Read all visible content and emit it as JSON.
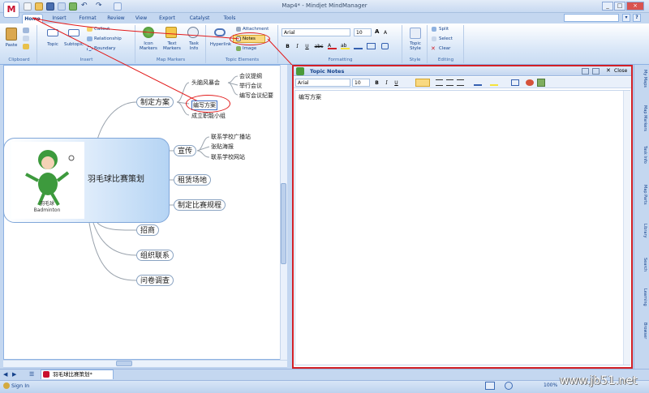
{
  "window": {
    "title": "Map4* - Mindjet MindManager",
    "app_button": "M",
    "controls": [
      "_",
      "□",
      "×"
    ]
  },
  "tabs": [
    "Home",
    "Insert",
    "Format",
    "Review",
    "View",
    "Export",
    "Catalyst",
    "Tools"
  ],
  "ribbon": {
    "clipboard": {
      "paste": "Paste",
      "label": "Clipboard"
    },
    "insert": {
      "topic": "Topic",
      "subtopic": "Subtopic",
      "callout": "Callout",
      "relationship": "Relationship",
      "boundary": "Boundary",
      "label": "Insert"
    },
    "map_markers": {
      "icon_markers": "Icon\nMarkers",
      "text_markers": "Text\nMarkers",
      "task_info": "Task\nInfo",
      "label": "Map Markers"
    },
    "topic_elements": {
      "hyperlink": "Hyperlink",
      "attachment": "Attachment",
      "notes": "Notes",
      "image": "Image",
      "label": "Topic Elements"
    },
    "formatting": {
      "font": "Arial",
      "size": "10",
      "bold": "B",
      "italic": "I",
      "underline": "U",
      "strike": "abc",
      "label": "Formatting"
    },
    "style": {
      "topic_style": "Topic\nStyle",
      "label": "Style"
    },
    "editing": {
      "split": "Split",
      "select": "Select",
      "clear": "Clear",
      "label": "Editing"
    }
  },
  "map": {
    "central": {
      "title": "羽毛球比赛策划",
      "img_caption_cn": "羽毛球",
      "img_caption_en": "Badminton"
    },
    "topics": [
      {
        "label": "制定方案",
        "subs": [
          "头脑风暴会",
          "编写方案",
          "成立职能小组"
        ],
        "sub_subs": [
          "会议提纲",
          "举行会议",
          "编写会议纪要"
        ]
      },
      {
        "label": "宣传",
        "subs": [
          "联系学校广播站",
          "张贴海报",
          "联系学校网站"
        ]
      },
      {
        "label": "租赁场地"
      },
      {
        "label": "制定比赛规程"
      },
      {
        "label": "招商"
      },
      {
        "label": "组织联系"
      },
      {
        "label": "问卷调查"
      }
    ]
  },
  "notes_pane": {
    "title": "Topic Notes",
    "close": "Close",
    "font": "Arial",
    "size": "10",
    "content": "编写方案"
  },
  "right_panel": [
    "My Maps",
    "Map Markers",
    "Task Info",
    "Map Parts",
    "Library",
    "Search",
    "Learning",
    "Browser"
  ],
  "document_tab": "羽毛球比赛策划*",
  "status": {
    "sign_in": "Sign In",
    "zoom": "100%"
  },
  "watermark": "www.jb51.net",
  "colors": {
    "accent": "#15428b",
    "highlight": "#e21b1b",
    "ribbon_bg": "#dbe8f8"
  }
}
